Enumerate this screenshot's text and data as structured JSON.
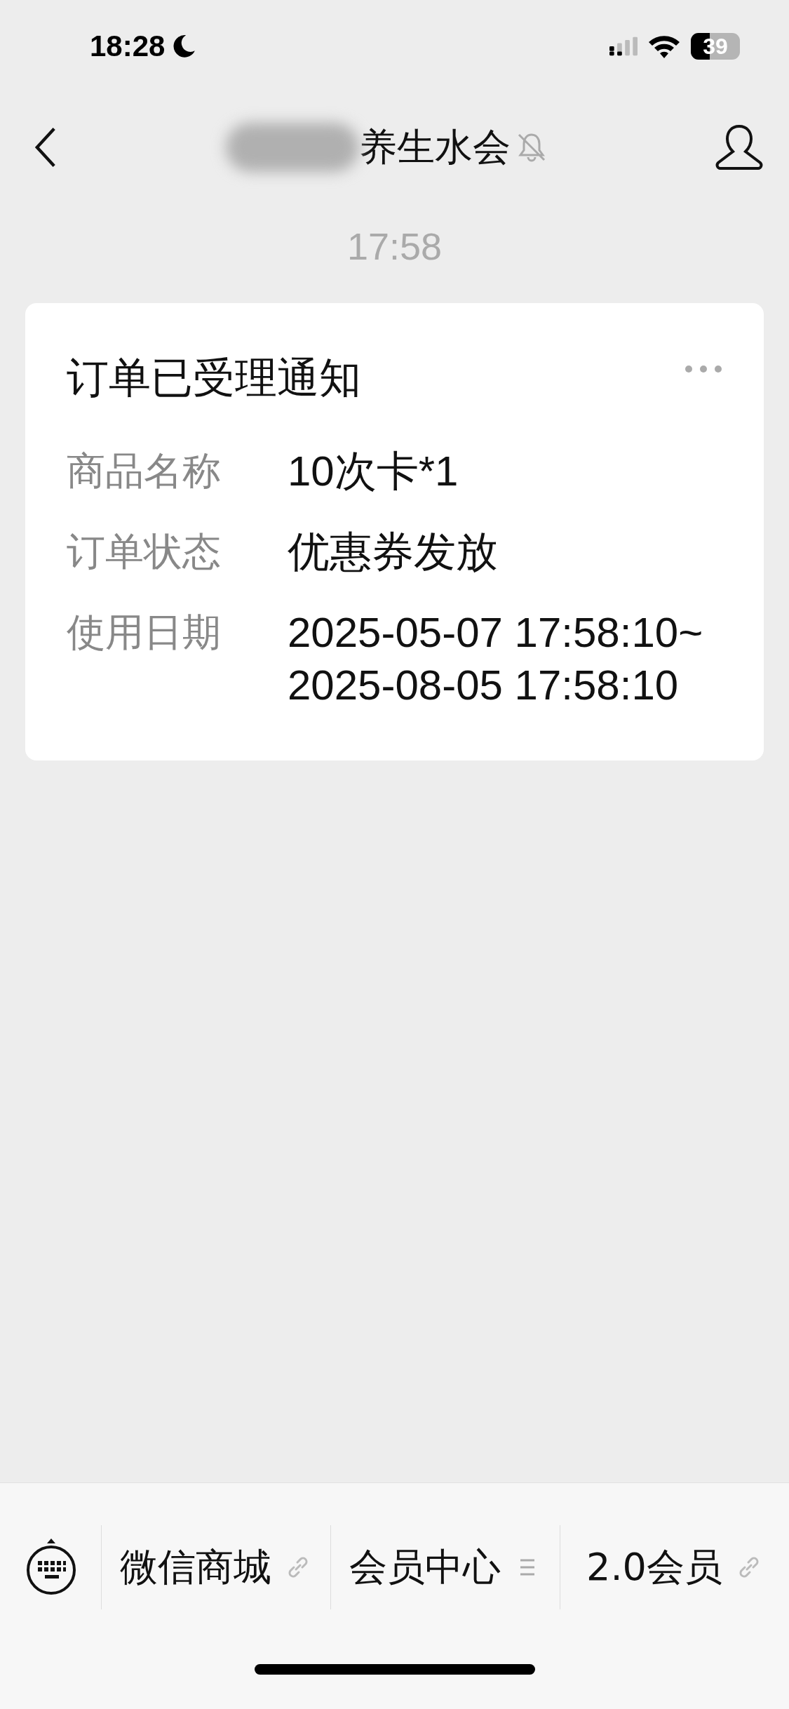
{
  "status_bar": {
    "time": "18:28",
    "battery": "39"
  },
  "header": {
    "title": "养生水会",
    "title_blurred": true,
    "muted": true
  },
  "timestamp": "17:58",
  "card": {
    "title": "订单已受理通知",
    "fields": [
      {
        "label": "商品名称",
        "value": "10次卡*1"
      },
      {
        "label": "订单状态",
        "value": "优惠券发放"
      },
      {
        "label": "使用日期",
        "value": "2025-05-07 17:58:10~2025-08-05 17:58:10"
      }
    ]
  },
  "menu": [
    {
      "label": "微信商城",
      "kind": "link"
    },
    {
      "label": "会员中心",
      "kind": "list"
    },
    {
      "label": "2.0会员",
      "kind": "link"
    }
  ]
}
